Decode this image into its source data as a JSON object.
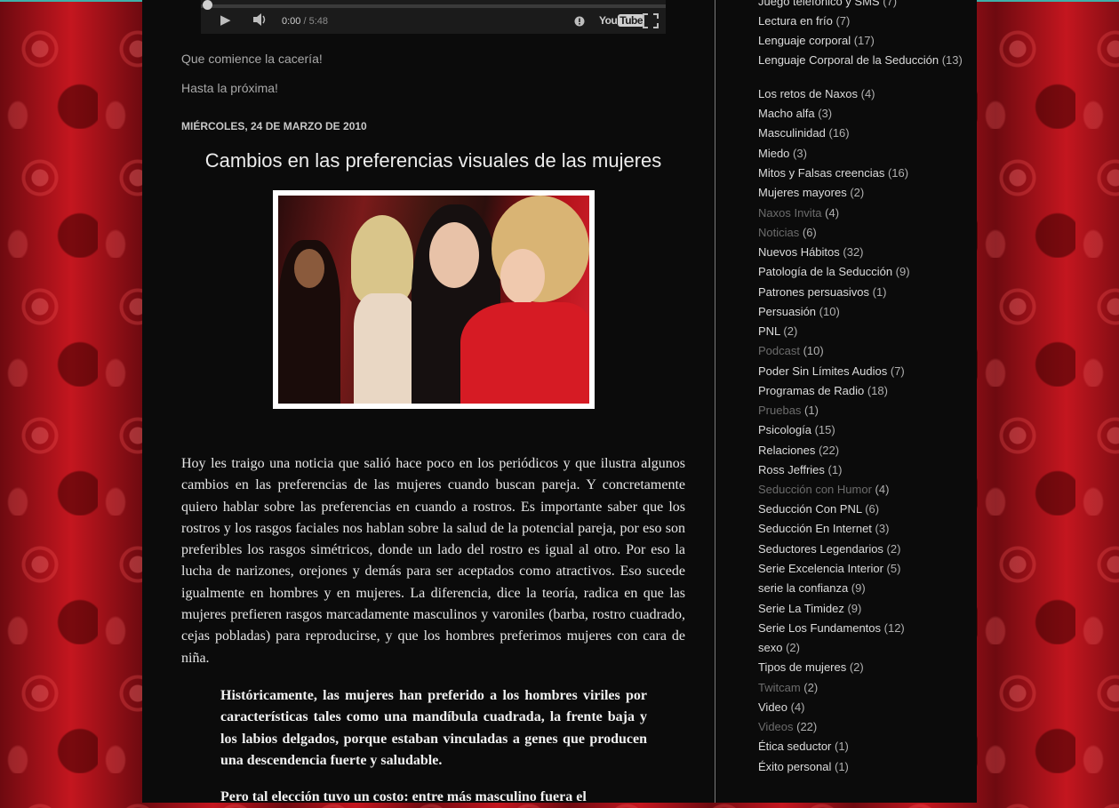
{
  "player": {
    "current_time": "0:00",
    "separator": "/",
    "duration": "5:48",
    "icons": [
      "play-icon",
      "volume-icon",
      "info-icon",
      "youtube-logo",
      "fullscreen-icon"
    ],
    "logo_text_a": "You",
    "logo_text_b": "Tube"
  },
  "post_end": {
    "line1": "Que comience la cacería!",
    "line2": "Hasta la próxima!"
  },
  "post": {
    "date": "MIÉRCOLES, 24 DE MARZO DE 2010",
    "title": "Cambios en las preferencias visuales de las mujeres",
    "body": "Hoy les traigo una noticia que salió hace poco en los periódicos y que ilustra algunos cambios en las preferencias de las mujeres cuando buscan pareja. Y concretamente quiero hablar sobre las preferencias en cuando a rostros. Es importante saber que los rostros y los rasgos faciales nos hablan sobre la salud de la potencial pareja, por eso son preferibles los rasgos simétricos, donde un lado del rostro es igual al otro. Por eso la lucha de narizones, orejones y demás para ser aceptados como atractivos. Eso sucede igualmente en hombres y en mujeres. La diferencia, dice la teoría, radica en que las mujeres prefieren rasgos marcadamente masculinos y varoniles (barba, rostro cuadrado, cejas pobladas) para reproducirse, y que los hombres preferimos mujeres con cara de niña.",
    "quote": "Históricamente, las mujeres han preferido a los hombres viriles por características tales como una mandíbula cuadrada, la frente baja y los labios delgados, porque estaban vinculadas a genes que producen una descendencia fuerte y saludable.",
    "quote_cont": "Pero tal elección tuvo un costo: entre más masculino fuera el"
  },
  "colors": {
    "background_red": "#b5121b",
    "panel": "#0b0b0b",
    "link": "#dcdcdc",
    "visited_link": "#6c6c6c"
  },
  "sidebar": {
    "labels": [
      {
        "name": "Juego telefónico y SMS",
        "count": "(7)",
        "visited": false
      },
      {
        "name": "Lectura en frío",
        "count": "(7)",
        "visited": false
      },
      {
        "name": "Lenguaje corporal",
        "count": "(17)",
        "visited": false
      },
      {
        "name": "Lenguaje Corporal de la Seducción",
        "count": "(13)",
        "visited": false
      },
      {
        "name": "Los retos de Naxos",
        "count": "(4)",
        "visited": false
      },
      {
        "name": "Macho alfa",
        "count": "(3)",
        "visited": false
      },
      {
        "name": "Masculinidad",
        "count": "(16)",
        "visited": false
      },
      {
        "name": "Miedo",
        "count": "(3)",
        "visited": false
      },
      {
        "name": "Mitos y Falsas creencias",
        "count": "(16)",
        "visited": false
      },
      {
        "name": "Mujeres mayores",
        "count": "(2)",
        "visited": false
      },
      {
        "name": "Naxos Invita",
        "count": "(4)",
        "visited": true
      },
      {
        "name": "Noticias",
        "count": "(6)",
        "visited": true
      },
      {
        "name": "Nuevos Hábitos",
        "count": "(32)",
        "visited": false
      },
      {
        "name": "Patología de la Seducción",
        "count": "(9)",
        "visited": false
      },
      {
        "name": "Patrones persuasivos",
        "count": "(1)",
        "visited": false
      },
      {
        "name": "Persuasión",
        "count": "(10)",
        "visited": false
      },
      {
        "name": "PNL",
        "count": "(2)",
        "visited": false
      },
      {
        "name": "Podcast",
        "count": "(10)",
        "visited": true
      },
      {
        "name": "Poder Sin Límites Audios",
        "count": "(7)",
        "visited": false
      },
      {
        "name": "Programas de Radio",
        "count": "(18)",
        "visited": false
      },
      {
        "name": "Pruebas",
        "count": "(1)",
        "visited": true
      },
      {
        "name": "Psicología",
        "count": "(15)",
        "visited": false
      },
      {
        "name": "Relaciones",
        "count": "(22)",
        "visited": false
      },
      {
        "name": "Ross Jeffries",
        "count": "(1)",
        "visited": false
      },
      {
        "name": "Seducción con Humor",
        "count": "(4)",
        "visited": true
      },
      {
        "name": "Seducción Con PNL",
        "count": "(6)",
        "visited": false
      },
      {
        "name": "Seducción En Internet",
        "count": "(3)",
        "visited": false
      },
      {
        "name": "Seductores Legendarios",
        "count": "(2)",
        "visited": false
      },
      {
        "name": "Serie Excelencia Interior",
        "count": "(5)",
        "visited": false
      },
      {
        "name": "serie la confianza",
        "count": "(9)",
        "visited": false
      },
      {
        "name": "Serie La Timidez",
        "count": "(9)",
        "visited": false
      },
      {
        "name": "Serie Los Fundamentos",
        "count": "(12)",
        "visited": false
      },
      {
        "name": "sexo",
        "count": "(2)",
        "visited": false
      },
      {
        "name": "Tipos de mujeres",
        "count": "(2)",
        "visited": false
      },
      {
        "name": "Twitcam",
        "count": "(2)",
        "visited": true
      },
      {
        "name": "Video",
        "count": "(4)",
        "visited": false
      },
      {
        "name": "Videos",
        "count": "(22)",
        "visited": true
      },
      {
        "name": "Ética seductor",
        "count": "(1)",
        "visited": false
      },
      {
        "name": "Éxito personal",
        "count": "(1)",
        "visited": false
      }
    ]
  }
}
